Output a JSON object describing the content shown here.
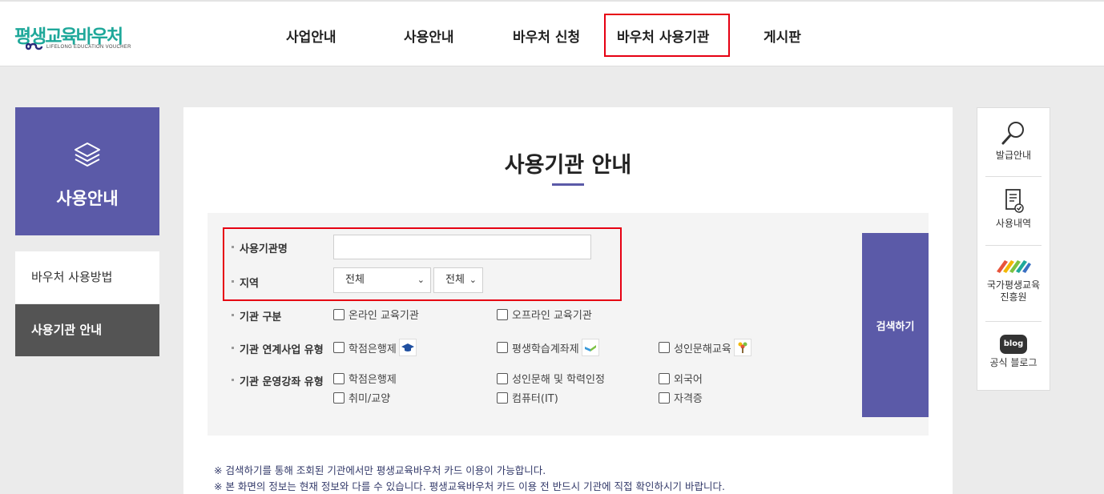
{
  "header": {
    "logo_text": "평생교육바우처",
    "logo_sub": "LIFELONG EDUCATION VOUCHER",
    "nav": [
      "사업안내",
      "사용안내",
      "바우처 신청",
      "바우처 사용기관",
      "게시판"
    ]
  },
  "sidebar": {
    "title": "사용안내",
    "items": [
      {
        "label": "바우처 사용방법",
        "active": false
      },
      {
        "label": "사용기관 안내",
        "active": true
      }
    ]
  },
  "main": {
    "title": "사용기관 안내",
    "search": {
      "name_label": "사용기관명",
      "name_value": "",
      "region_label": "지역",
      "region_select1": "전체",
      "region_select2": "전체",
      "type_label": "기관 구분",
      "type_options": [
        "온라인 교육기관",
        "오프라인 교육기관"
      ],
      "link_label": "기관 연계사업 유형",
      "link_options": [
        "학점은행제",
        "평생학습계좌제",
        "성인문해교육"
      ],
      "course_label": "기관 운영강좌 유형",
      "course_options": [
        "학점은행제",
        "성인문해 및 학력인정",
        "외국어",
        "취미/교양",
        "컴퓨터(IT)",
        "자격증"
      ],
      "button": "검색하기"
    },
    "notes": [
      "※ 검색하기를 통해 조회된 기관에서만 평생교육바우처 카드 이용이 가능합니다.",
      "※ 본 화면의 정보는 현재 정보와 다를 수 있습니다. 평생교육바우처 카드 이용 전 반드시 기관에 직접 확인하시기 바랍니다."
    ]
  },
  "quick_menu": [
    {
      "label": "발급안내",
      "icon": "magnifier-icon"
    },
    {
      "label": "사용내역",
      "icon": "document-check-icon"
    },
    {
      "label": "국가평생교육\n진흥원",
      "icon": "nile-logo-icon"
    },
    {
      "label": "공식 블로그",
      "icon": "blog-icon",
      "badge": "blog"
    }
  ],
  "colors": {
    "accent": "#5b5aa8",
    "highlight": "#e60012",
    "logo": "#1fa89a"
  }
}
